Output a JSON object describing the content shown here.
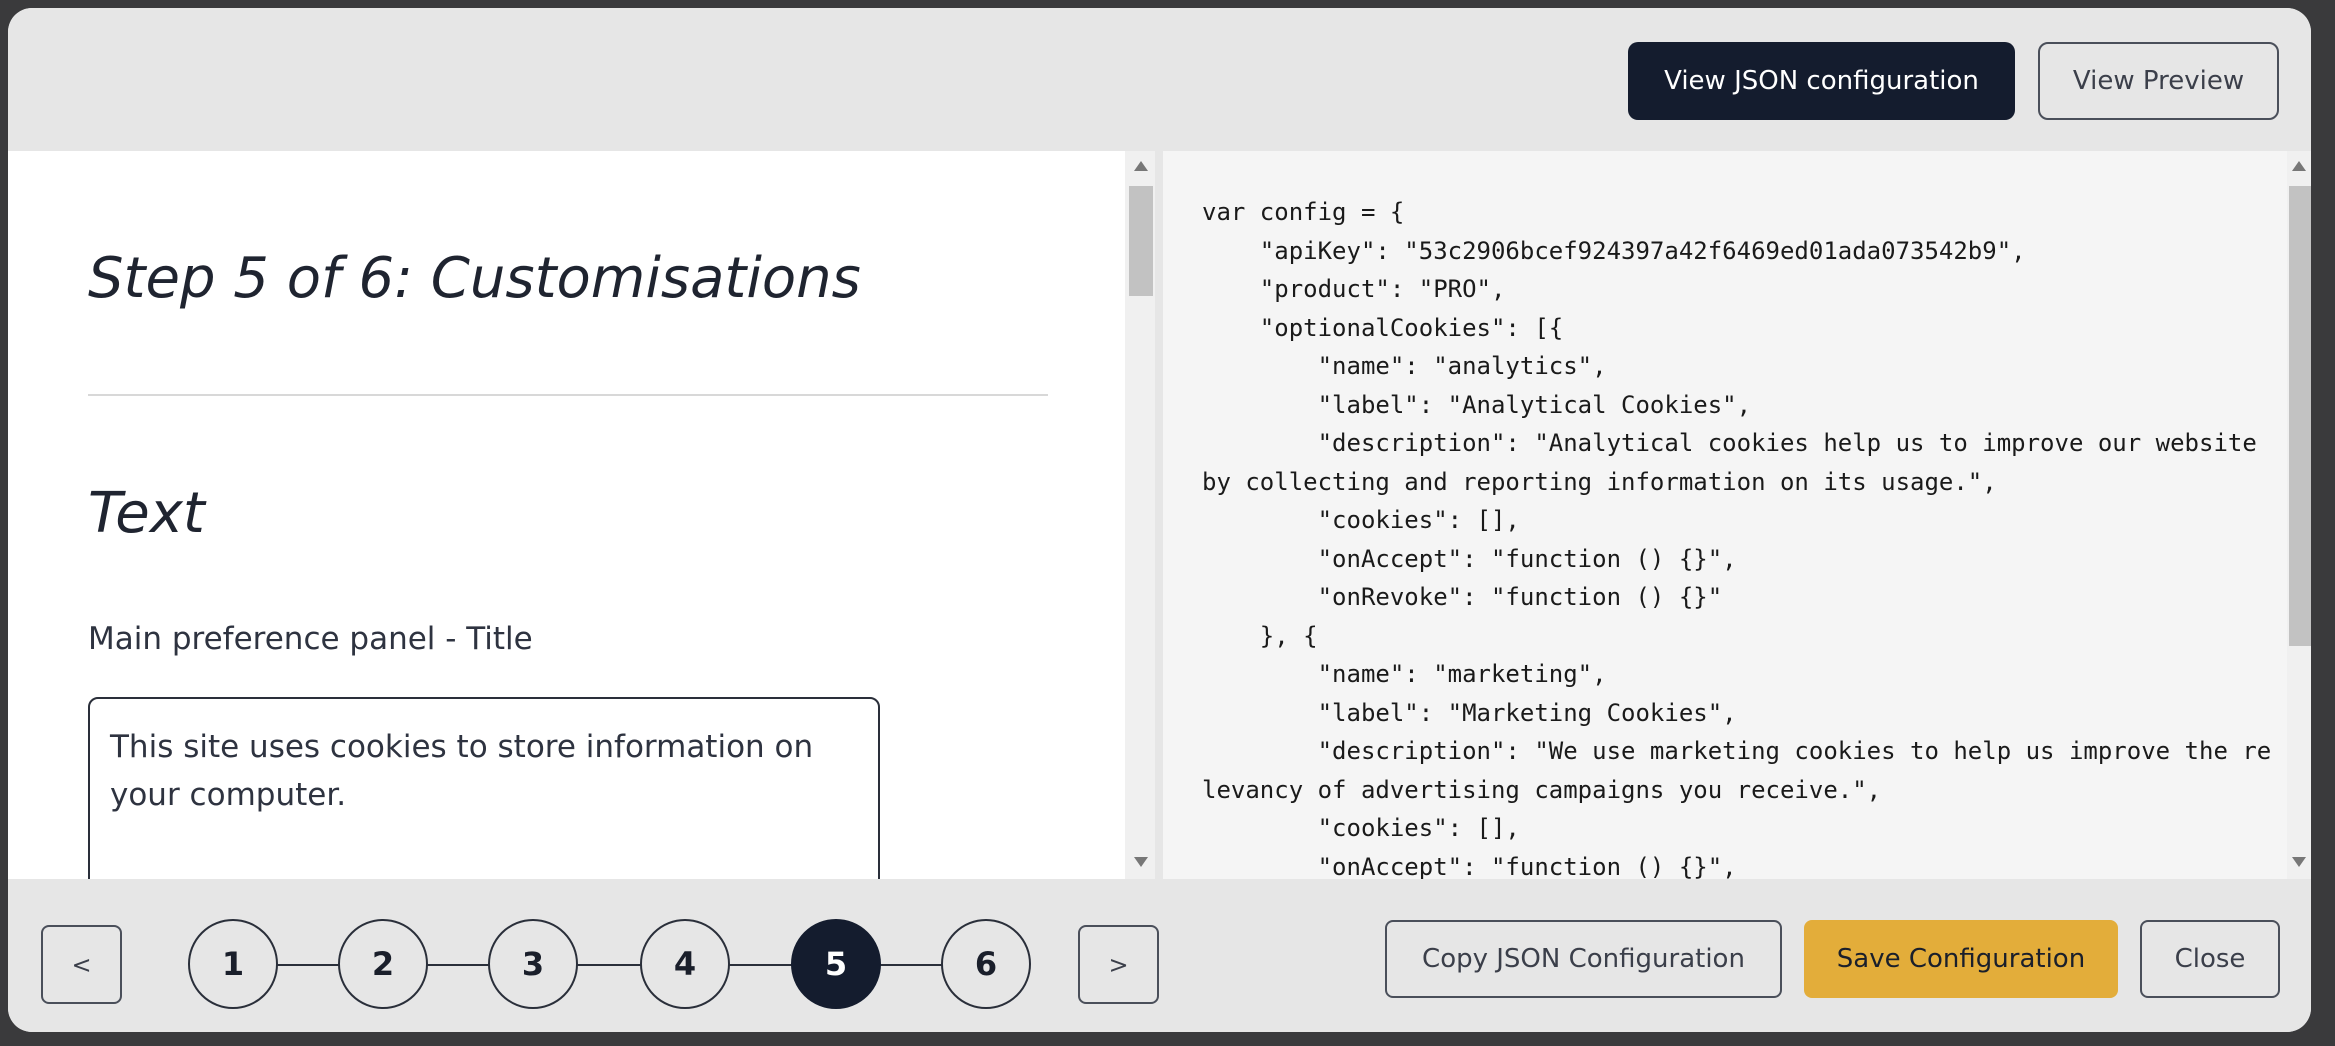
{
  "header": {
    "json_button": "View JSON configuration",
    "preview_button": "View Preview"
  },
  "form": {
    "step_title": "Step 5 of 6: Customisations",
    "section_title": "Text",
    "field_label": "Main preference panel - Title",
    "field_value": "This site uses cookies to store information on your computer."
  },
  "code": {
    "lines": [
      "var config = {",
      "    \"apiKey\": \"53c2906bcef924397a42f6469ed01ada073542b9\",",
      "    \"product\": \"PRO\",",
      "    \"optionalCookies\": [{",
      "        \"name\": \"analytics\",",
      "        \"label\": \"Analytical Cookies\",",
      "        \"description\": \"Analytical cookies help us to improve our website by collecting and reporting information on its usage.\",",
      "        \"cookies\": [],",
      "        \"onAccept\": \"function () {}\",",
      "        \"onRevoke\": \"function () {}\"",
      "    }, {",
      "        \"name\": \"marketing\",",
      "        \"label\": \"Marketing Cookies\",",
      "        \"description\": \"We use marketing cookies to help us improve the relevancy of advertising campaigns you receive.\",",
      "        \"cookies\": [],",
      "        \"onAccept\": \"function () {}\","
    ]
  },
  "footer": {
    "prev_label": "<",
    "next_label": ">",
    "steps": [
      "1",
      "2",
      "3",
      "4",
      "5",
      "6"
    ],
    "active_step": 5,
    "copy_button": "Copy JSON Configuration",
    "save_button": "Save Configuration",
    "close_button": "Close"
  },
  "colors": {
    "primary_dark": "#141c2e",
    "accent": "#e3ad3a",
    "background": "#e6e6e6"
  }
}
